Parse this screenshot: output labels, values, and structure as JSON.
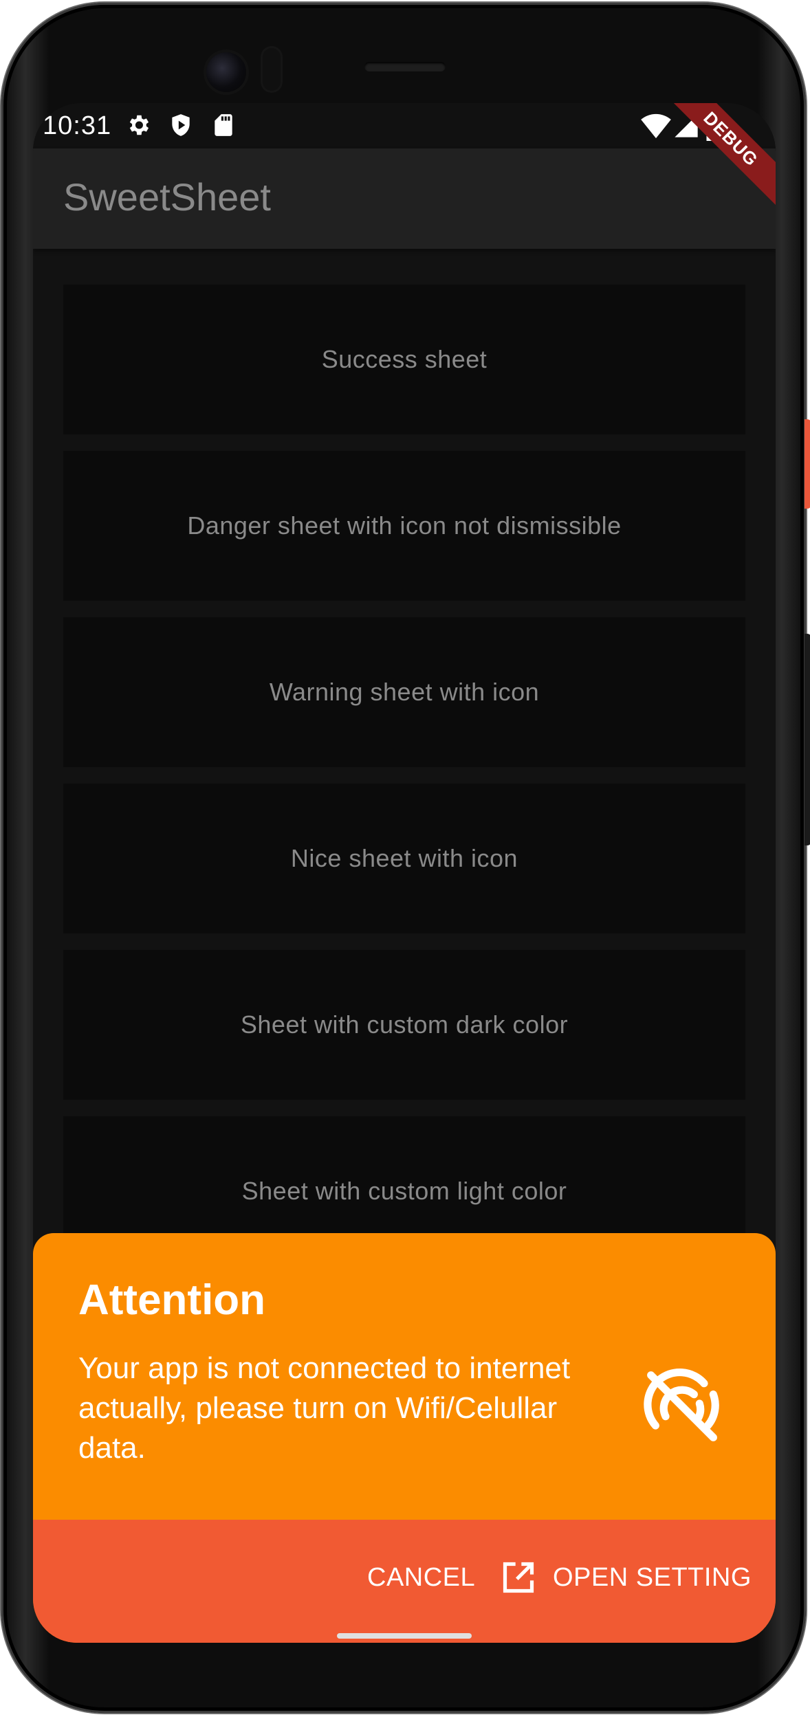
{
  "status_bar": {
    "time": "10:31",
    "left_icons": [
      "settings-icon",
      "shield-icon",
      "sd-card-icon"
    ],
    "right_icons": [
      "wifi-icon",
      "signal-icon",
      "battery-icon"
    ]
  },
  "debug_banner": "DEBUG",
  "app_bar": {
    "title": "SweetSheet"
  },
  "buttons": [
    "Success sheet",
    "Danger sheet with icon not dismissible",
    "Warning sheet with icon",
    "Nice sheet with icon",
    "Sheet with custom dark color",
    "Sheet with custom light color"
  ],
  "sheet": {
    "title": "Attention",
    "description": "Your app is not connected to internet actually, please turn on Wifi/Celullar data.",
    "icon": "wifi-off-icon",
    "cancel_label": "CANCEL",
    "open_label": "OPEN SETTING",
    "open_icon": "open-external-icon"
  },
  "colors": {
    "sheet_bg": "#fb8c00",
    "actions_bg": "#f15a33",
    "app_bg": "#121212",
    "list_item_bg": "#0b0b0b",
    "app_bar_bg": "#212121",
    "debug_banner": "#8a1c1c"
  }
}
